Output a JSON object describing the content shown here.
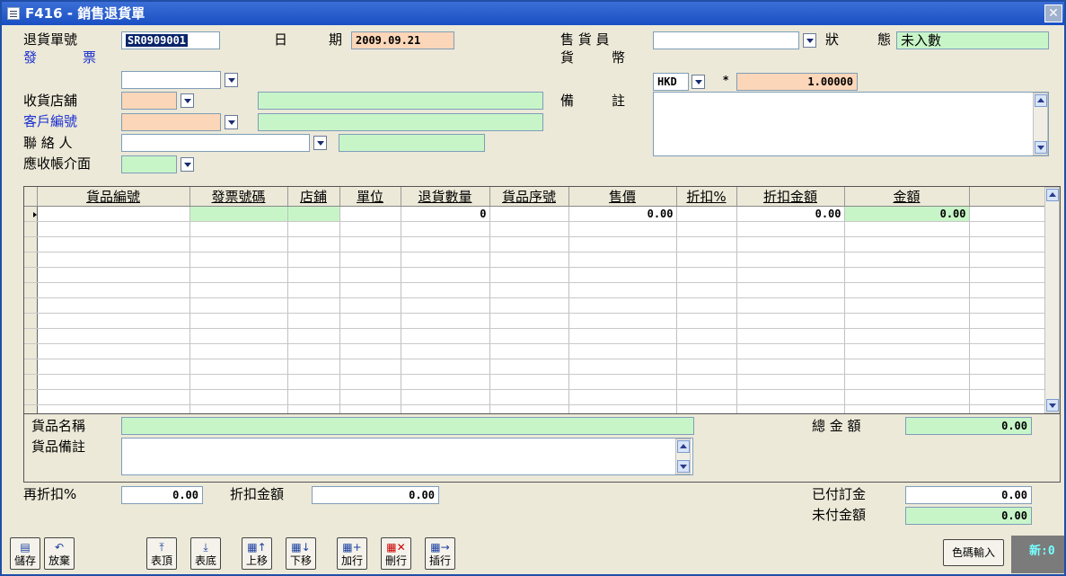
{
  "window": {
    "title": "F416 - 銷售退貨單",
    "close_glyph": "✕"
  },
  "header": {
    "return_no_label": "退貨單號",
    "return_no": "SR0909001",
    "date_label_1": "日",
    "date_label_2": "期",
    "date": "2009.09.21",
    "salesperson_label": "售 貨 員",
    "salesperson": "",
    "status_label_1": "狀",
    "status_label_2": "態",
    "status": "未入數",
    "invoice_label_1": "發",
    "invoice_label_2": "票",
    "invoice": "",
    "currency_label_1": "貨",
    "currency_label_2": "幣",
    "currency": "HKD",
    "rate_sign": "*",
    "rate": "1.00000",
    "store_label": "收貨店舖",
    "store_code": "",
    "store_name": "",
    "remarks_label_1": "備",
    "remarks_label_2": "註",
    "remarks": "",
    "customer_label": "客戶編號",
    "customer_code": "",
    "customer_name": "",
    "contact_label": "聯 絡 人",
    "contact": "",
    "contact_extra": "",
    "ar_label": "應收帳介面",
    "ar_value": ""
  },
  "grid": {
    "columns": [
      "貨品編號",
      "發票號碼",
      "店鋪",
      "單位",
      "退貨數量",
      "貨品序號",
      "售價",
      "折扣%",
      "折扣金額",
      "金額"
    ],
    "rows": [
      [
        "",
        "",
        "",
        "",
        "0",
        "",
        "0.00",
        "",
        "0.00",
        "0.00"
      ]
    ],
    "empty_rows": 13
  },
  "detail": {
    "product_name_label": "貨品名稱",
    "product_name": "",
    "product_remarks_label": "貨品備註",
    "product_remarks": "",
    "total_label": "總 金 額",
    "total": "0.00"
  },
  "footer": {
    "rediscount_label": "再折扣%",
    "rediscount": "0.00",
    "discount_amount_label": "折扣金額",
    "discount_amount": "0.00",
    "deposit_label": "已付訂金",
    "deposit": "0.00",
    "unpaid_label": "未付金額",
    "unpaid": "0.00"
  },
  "toolbar": {
    "save": "儲存",
    "discard": "放棄",
    "top": "表頂",
    "bottom": "表底",
    "move_up": "上移",
    "move_down": "下移",
    "add_row": "加行",
    "delete_row": "刪行",
    "insert_row": "插行",
    "color_code_input": "色碼輸入",
    "mode_status": "新:0"
  },
  "colors": {
    "title_bar": "#1a4fc4",
    "green_field": "#c8f5c8",
    "peach_field": "#fbd6b8",
    "link_label": "#1b2fd0"
  }
}
